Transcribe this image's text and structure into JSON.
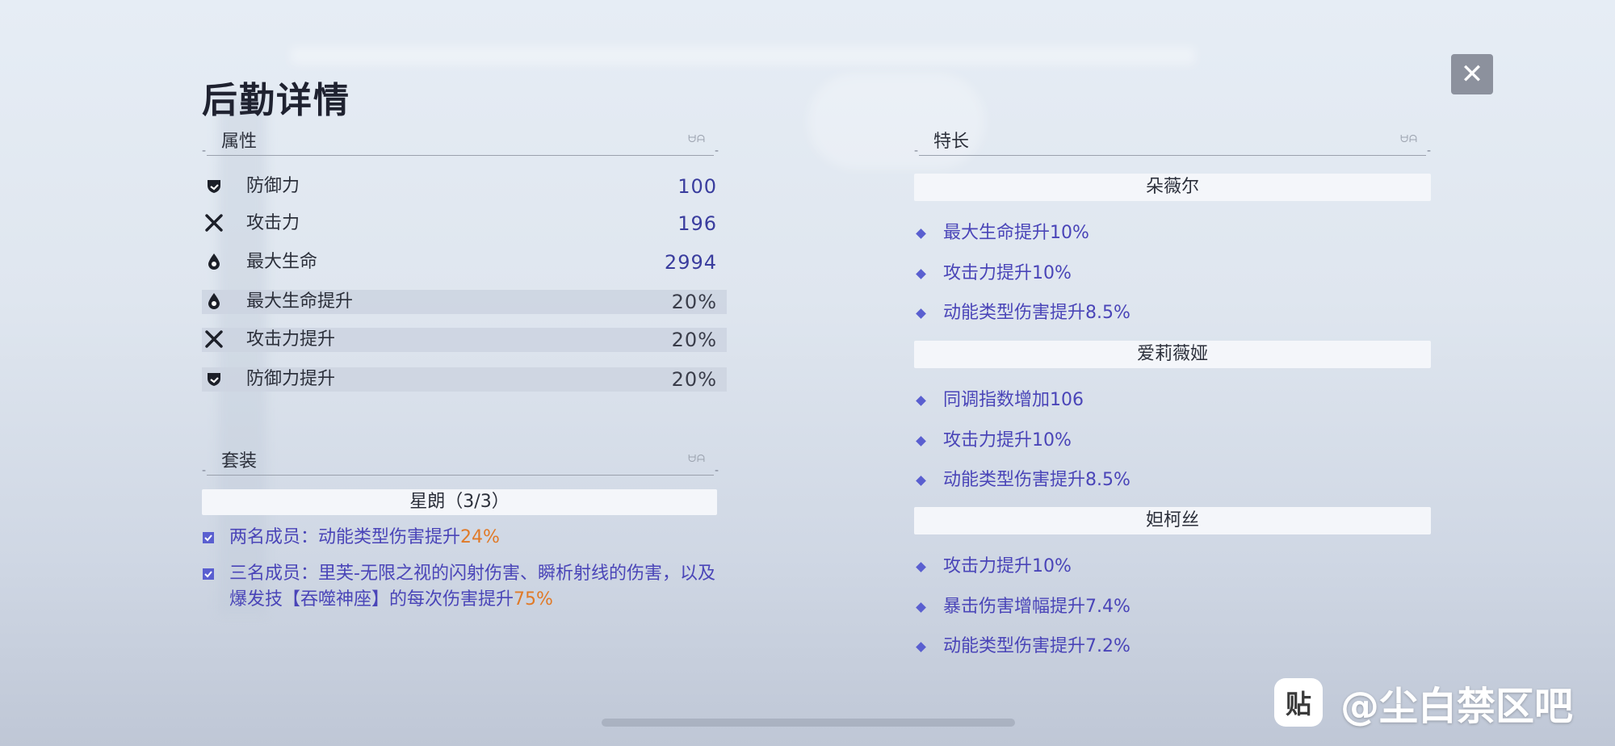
{
  "title": "后勤详情",
  "close_label": "✕",
  "attributes": {
    "header": "属性",
    "rows": [
      {
        "icon": "shield-icon",
        "name": "防御力",
        "value": "100"
      },
      {
        "icon": "crossed-swords-icon",
        "name": "攻击力",
        "value": "196"
      },
      {
        "icon": "drop-icon",
        "name": "最大生命",
        "value": "2994"
      },
      {
        "icon": "drop-icon",
        "name": "最大生命提升",
        "value": "20%"
      },
      {
        "icon": "crossed-swords-icon",
        "name": "攻击力提升",
        "value": "20%"
      },
      {
        "icon": "shield-icon",
        "name": "防御力提升",
        "value": "20%"
      }
    ]
  },
  "set": {
    "header": "套装",
    "name": "星朗（3/3）",
    "effects": [
      {
        "text": "两名成员：动能类型伤害提升",
        "highlight": "24%"
      },
      {
        "text": "三名成员：里芙-无限之视的闪射伤害、瞬析射线的伤害，以及爆发技【吞噬神座】的每次伤害提升",
        "highlight": "75%"
      }
    ]
  },
  "specialties": {
    "header": "特长",
    "characters": [
      {
        "name": "朵薇尔",
        "bonuses": [
          "最大生命提升10%",
          "攻击力提升10%",
          "动能类型伤害提升8.5%"
        ]
      },
      {
        "name": "爱莉薇娅",
        "bonuses": [
          "同调指数增加106",
          "攻击力提升10%",
          "动能类型伤害提升8.5%"
        ]
      },
      {
        "name": "妲柯丝",
        "bonuses": [
          "攻击力提升10%",
          "暴击伤害增幅提升7.4%",
          "动能类型伤害提升7.2%"
        ]
      }
    ]
  },
  "watermark": {
    "logo": "贴",
    "text": "@尘白禁区吧"
  },
  "colors": {
    "accent": "#4a45b8",
    "highlight": "#e07a28",
    "value": "#3a3d9e"
  }
}
